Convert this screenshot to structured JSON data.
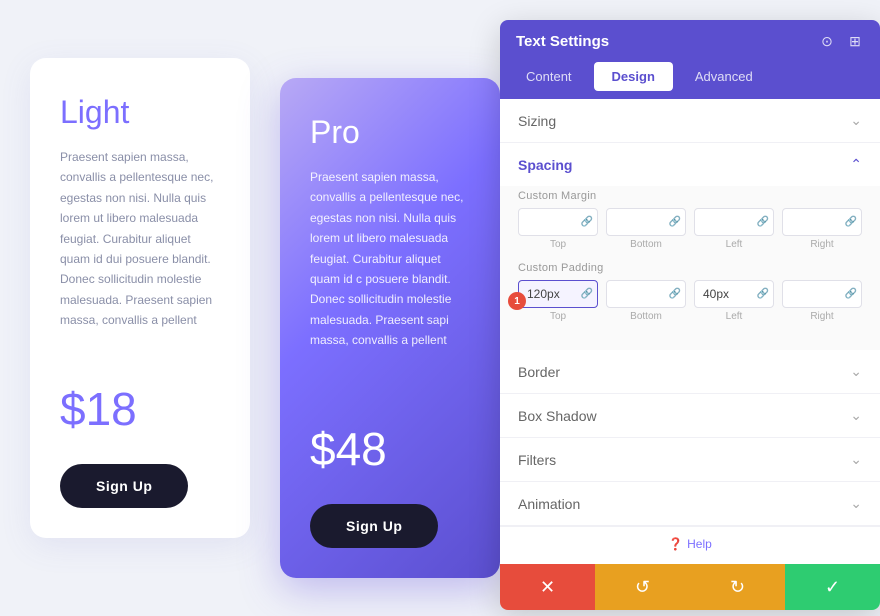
{
  "cards": {
    "light": {
      "name": "Light",
      "description": "Praesent sapien massa, convallis a pellentesque nec, egestas non nisi. Nulla quis lorem ut libero malesuada feugiat. Curabitur aliquet quam id dui posuere blandit. Donec sollicitudin molestie malesuada. Praesent sapien massa, convallis a pellent",
      "price": "$18",
      "button": "Sign Up"
    },
    "pro": {
      "name": "Pro",
      "description": "Praesent sapien massa, convallis a pellentesque nec, egestas non nisi. Nulla quis lorem ut libero malesuada feugiat. Curabitur aliquet quam id c posuere blandit. Donec sollicitudin molestie malesuada. Praesent sapi massa, convallis a pellent",
      "price": "$48",
      "button": "Sign Up"
    }
  },
  "panel": {
    "title": "Text Settings",
    "tabs": [
      {
        "label": "Content",
        "active": false
      },
      {
        "label": "Design",
        "active": true
      },
      {
        "label": "Advanced",
        "active": false
      }
    ],
    "sections": [
      {
        "label": "Sizing",
        "expanded": false
      },
      {
        "label": "Spacing",
        "expanded": true
      },
      {
        "label": "Border",
        "expanded": false
      },
      {
        "label": "Box Shadow",
        "expanded": false
      },
      {
        "label": "Filters",
        "expanded": false
      },
      {
        "label": "Animation",
        "expanded": false
      }
    ],
    "spacing": {
      "custom_margin_label": "Custom Margin",
      "margin_fields": [
        {
          "sublabel": "Top",
          "value": ""
        },
        {
          "sublabel": "Bottom",
          "value": ""
        },
        {
          "sublabel": "Left",
          "value": ""
        },
        {
          "sublabel": "Right",
          "value": ""
        }
      ],
      "custom_padding_label": "Custom Padding",
      "padding_fields": [
        {
          "sublabel": "Top",
          "value": "120px"
        },
        {
          "sublabel": "Bottom",
          "value": ""
        },
        {
          "sublabel": "Left",
          "value": "40px"
        },
        {
          "sublabel": "Right",
          "value": ""
        }
      ],
      "notification": "1"
    },
    "help_label": "Help",
    "footer": {
      "cancel": "✕",
      "undo": "↺",
      "redo": "↻",
      "confirm": "✓"
    }
  }
}
